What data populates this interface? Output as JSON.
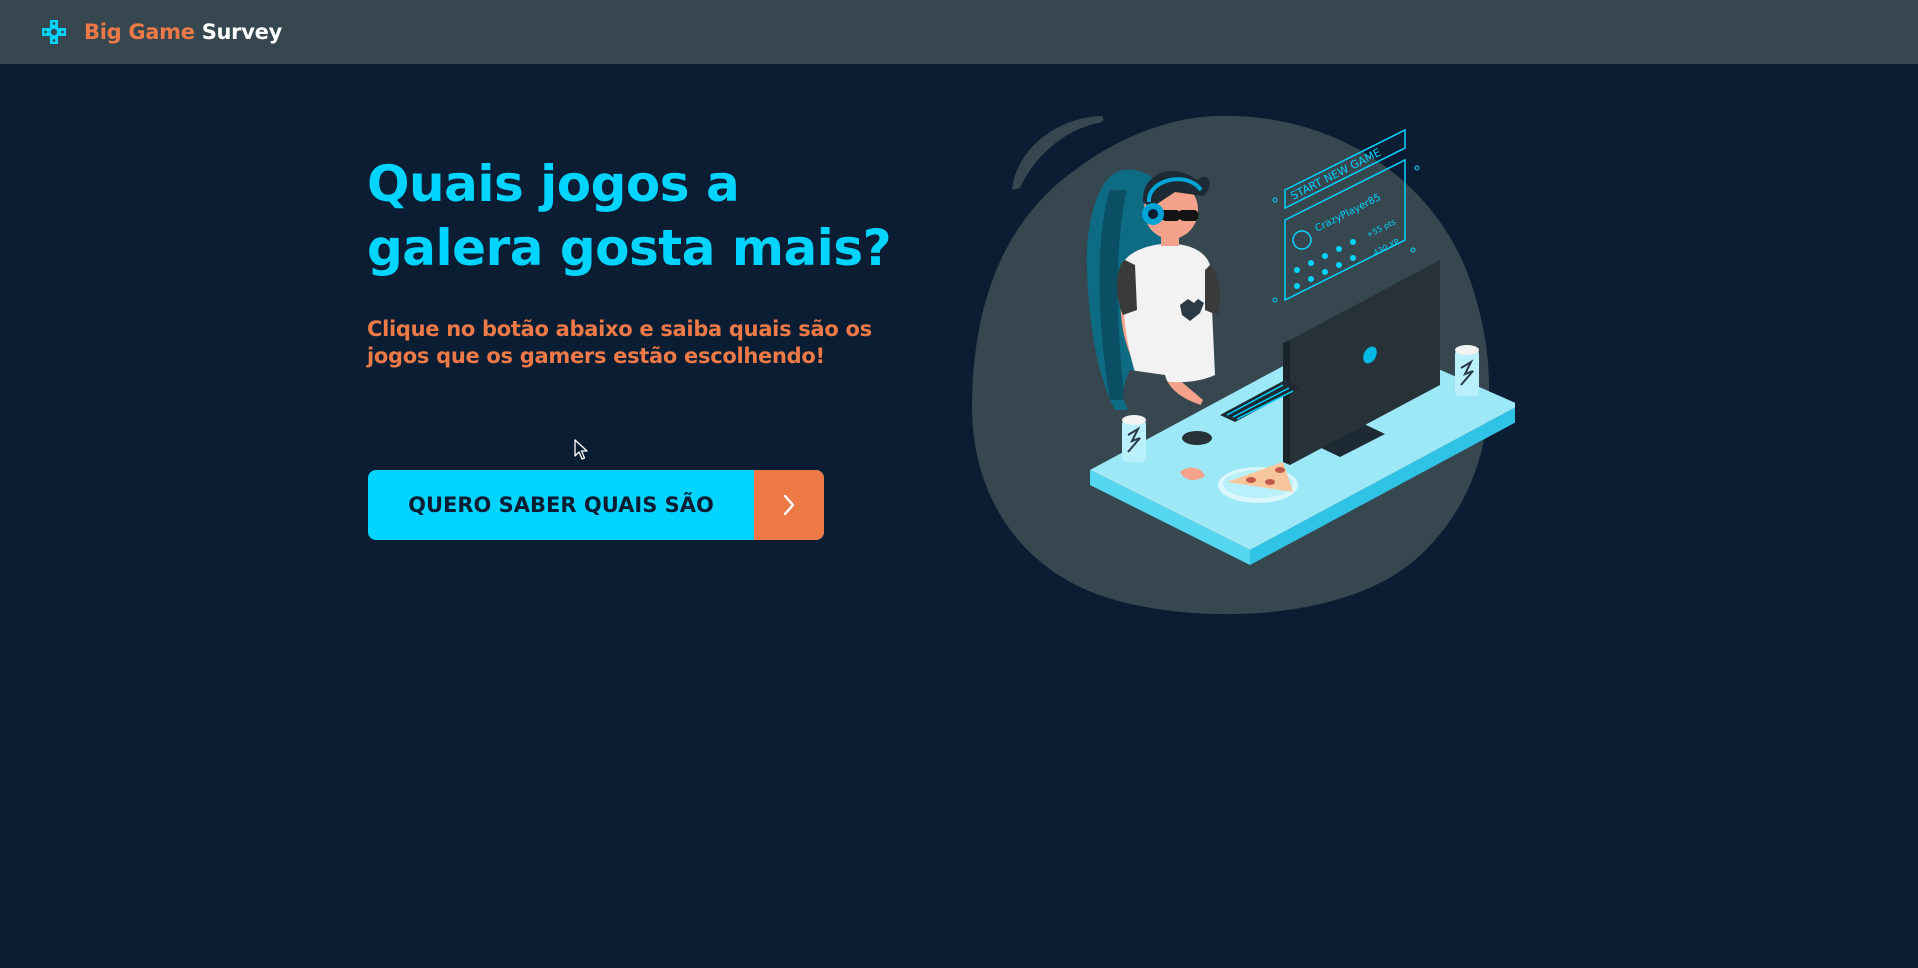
{
  "header": {
    "brand_part1": "Big Game",
    "brand_part2": "Survey",
    "logo_icon": "gamepad-cross-icon"
  },
  "hero": {
    "title_line1": "Quais jogos a",
    "title_line2": "galera gosta mais?",
    "subtitle_line1": "Clique no botão abaixo e saiba quais são os",
    "subtitle_line2": "jogos que os gamers estão escolhendo!",
    "cta_label": "QUERO SABER QUAIS SÃO",
    "cta_icon": "chevron-right-icon"
  },
  "illustration": {
    "screen_title": "START NEW GAME",
    "player_name": "CrazyPlayer85",
    "stat1": "+55 pts",
    "stat2": "430 XP"
  },
  "colors": {
    "background": "#0b1d33",
    "navbar": "#37474f",
    "accent_cyan": "#00d4ff",
    "accent_orange": "#ed7947"
  }
}
